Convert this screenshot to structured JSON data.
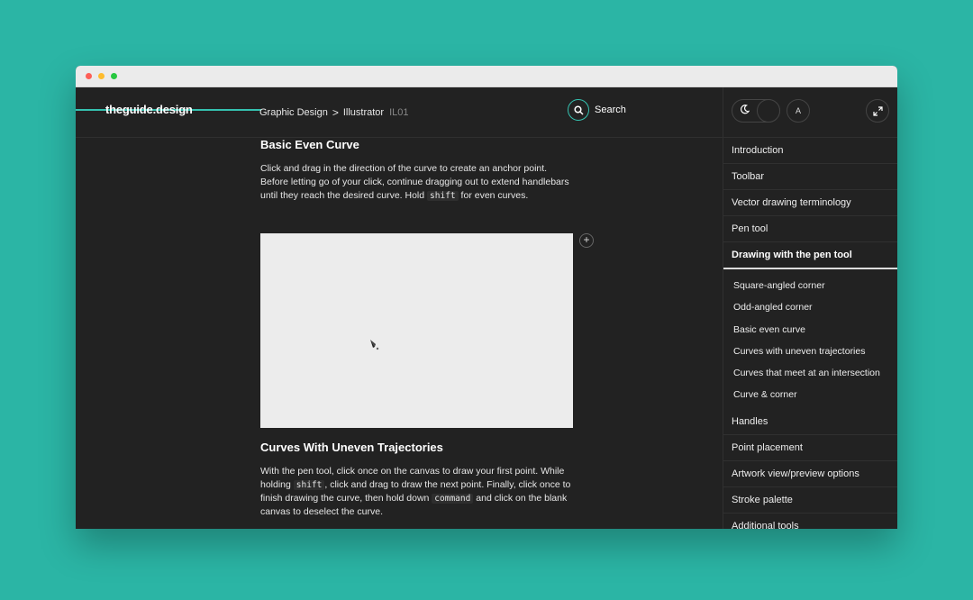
{
  "header": {
    "logo": "theguide.design",
    "breadcrumb": [
      "Graphic Design",
      "Illustrator"
    ],
    "breadcrumb_separator": ">",
    "lesson_code": "IL01",
    "search_label": "Search"
  },
  "controls": {
    "theme_icon": "moon-icon",
    "font_button_label": "A",
    "fullscreen_icon": "expand-icon"
  },
  "main": {
    "section1_title": "Basic Even Curve",
    "section1_p_a": "Click and drag in the direction of the curve to create an anchor point. Before letting go of your click, continue dragging out to extend handlebars until they reach the desired curve. Hold ",
    "section1_code": "shift",
    "section1_p_b": " for even curves.",
    "expand_button": "+",
    "section2_title": "Curves With Uneven Trajectories",
    "section2_p_a": "With the pen tool, click once on the canvas to draw your first point. While holding ",
    "section2_code1": "shift",
    "section2_p_b": ", click and drag to draw the next point. Finally, click once to finish drawing the curve, then hold down ",
    "section2_code2": "command",
    "section2_p_c": " and click on the blank canvas to deselect the curve."
  },
  "sidebar": {
    "items_top": [
      "Introduction",
      "Toolbar",
      "Vector drawing terminology",
      "Pen tool"
    ],
    "active_item": "Drawing with the pen tool",
    "sub_items": [
      "Square-angled corner",
      "Odd-angled corner",
      "Basic even curve",
      "Curves with uneven trajectories",
      "Curves that meet at an intersection",
      "Curve & corner"
    ],
    "items_bottom": [
      "Handles",
      "Point placement",
      "Artwork view/preview options",
      "Stroke palette",
      "Additional tools"
    ]
  },
  "colors": {
    "accent": "#35c2b0",
    "background": "#2bb5a5",
    "panel": "#222222"
  }
}
